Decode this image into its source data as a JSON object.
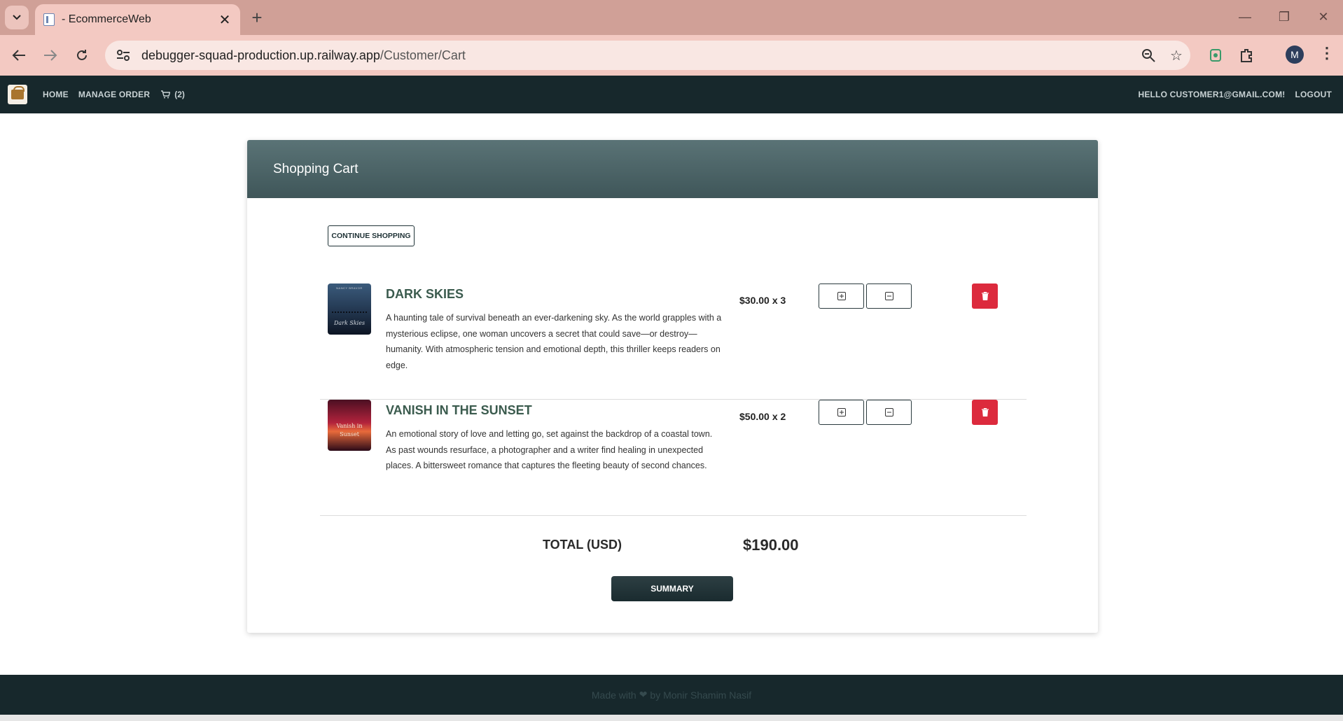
{
  "browser": {
    "tab_title": "- EcommerceWeb",
    "url_host": "debugger-squad-production.up.railway.app",
    "url_path": "/Customer/Cart",
    "profile_initial": "M"
  },
  "nav": {
    "home": "HOME",
    "manage_order": "MANAGE ORDER",
    "cart_count": "(2)",
    "greeting": "HELLO CUSTOMER1@GMAIL.COM!",
    "logout": "LOGOUT"
  },
  "cart": {
    "title": "Shopping Cart",
    "continue_label": "CONTINUE SHOPPING",
    "items": [
      {
        "title": "DARK SKIES",
        "description": "A haunting tale of survival beneath an ever-darkening sky. As the world grapples with a mysterious eclipse, one woman uncovers a secret that could save—or destroy—humanity. With atmospheric tension and emotional depth, this thriller keeps readers on edge.",
        "price": "$30.00",
        "qty": "x 3",
        "cover_text": "Dark Skies",
        "cover_author": "NANCY BRAVOR"
      },
      {
        "title": "VANISH IN THE SUNSET",
        "description": "An emotional story of love and letting go, set against the backdrop of a coastal town. As past wounds resurface, a photographer and a writer find healing in unexpected places. A bittersweet romance that captures the fleeting beauty of second chances.",
        "price": "$50.00",
        "qty": "x 2",
        "cover_text": "Vanish in Sunset"
      }
    ],
    "total_label": "TOTAL (USD)",
    "total_value": "$190.00",
    "summary_label": "SUMMARY"
  },
  "footer": {
    "prefix": "Made with",
    "suffix": "by Monir Shamim Nasif"
  },
  "colors": {
    "navbar": "#17282c",
    "header": "#4d6568",
    "delete": "#dc2a3d",
    "title_green": "#3b5b4e"
  }
}
